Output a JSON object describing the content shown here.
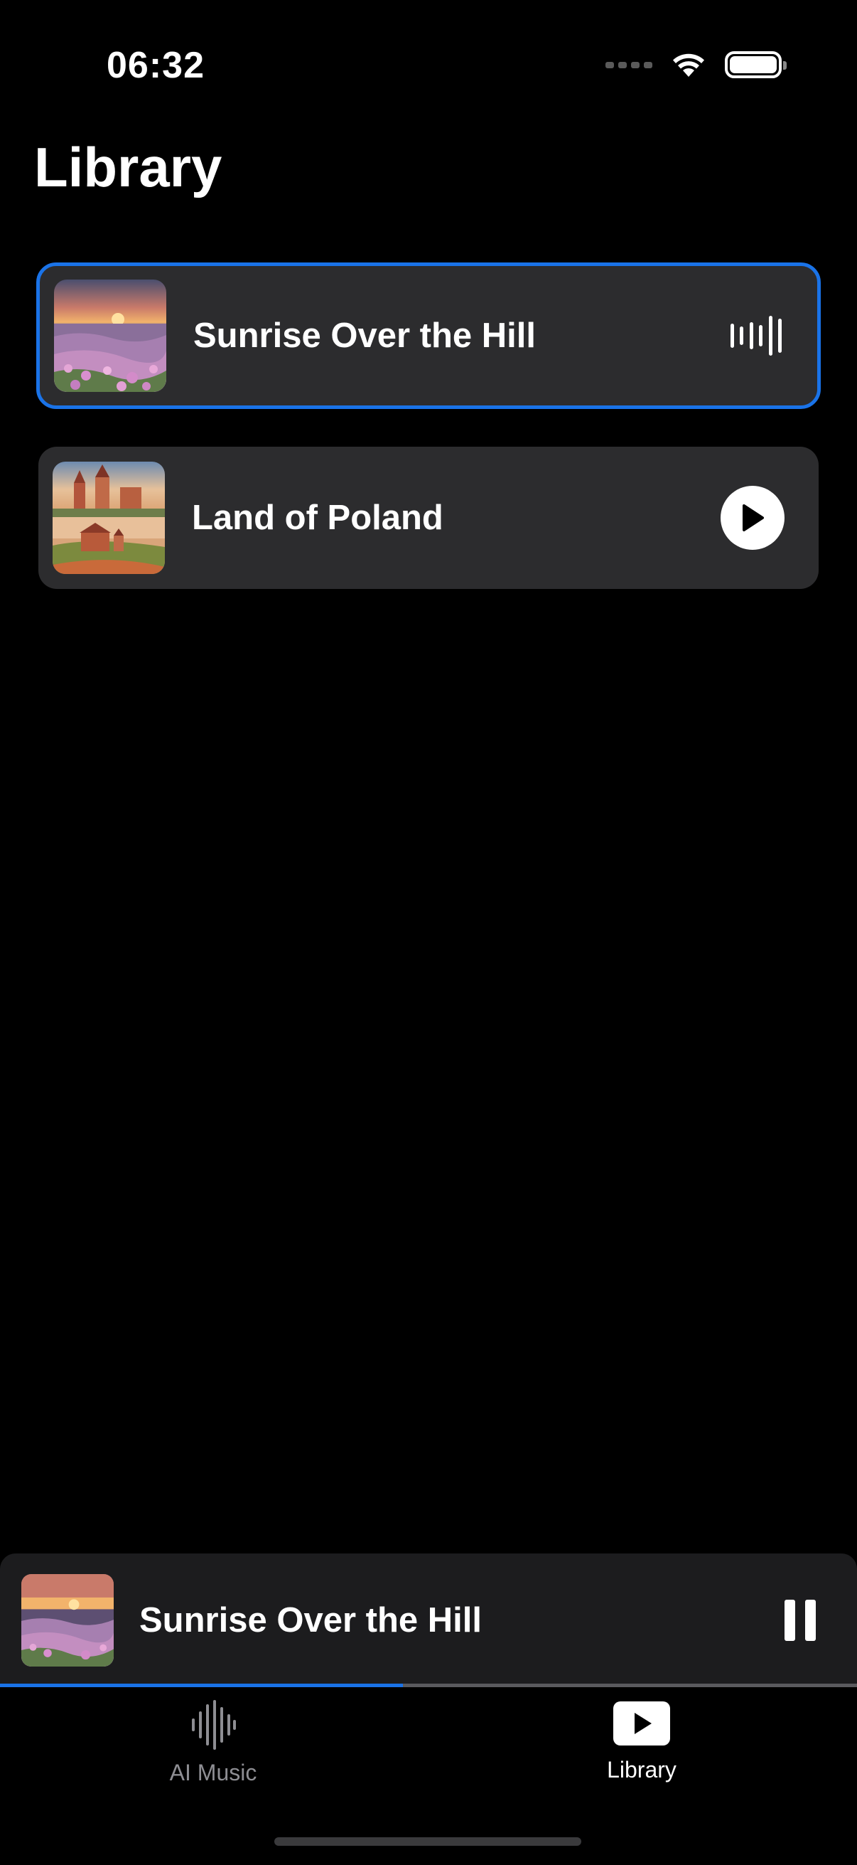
{
  "status_bar": {
    "time": "06:32"
  },
  "page": {
    "title": "Library"
  },
  "tracks": [
    {
      "title": "Sunrise Over the Hill",
      "state": "playing",
      "trailing_icon": "equalizer-icon"
    },
    {
      "title": "Land of Poland",
      "state": "paused",
      "trailing_icon": "play-icon"
    }
  ],
  "now_playing": {
    "title": "Sunrise Over the Hill",
    "control_icon": "pause-icon",
    "progress": 0.47
  },
  "tab_bar": {
    "tabs": [
      {
        "label": "AI Music",
        "icon": "waveform-icon",
        "active": false
      },
      {
        "label": "Library",
        "icon": "play-rectangle-icon",
        "active": true
      }
    ]
  },
  "colors": {
    "accent": "#1a73e8",
    "card_bg": "#2c2c2e",
    "background": "#000000",
    "inactive_tab": "#8e8e93"
  }
}
